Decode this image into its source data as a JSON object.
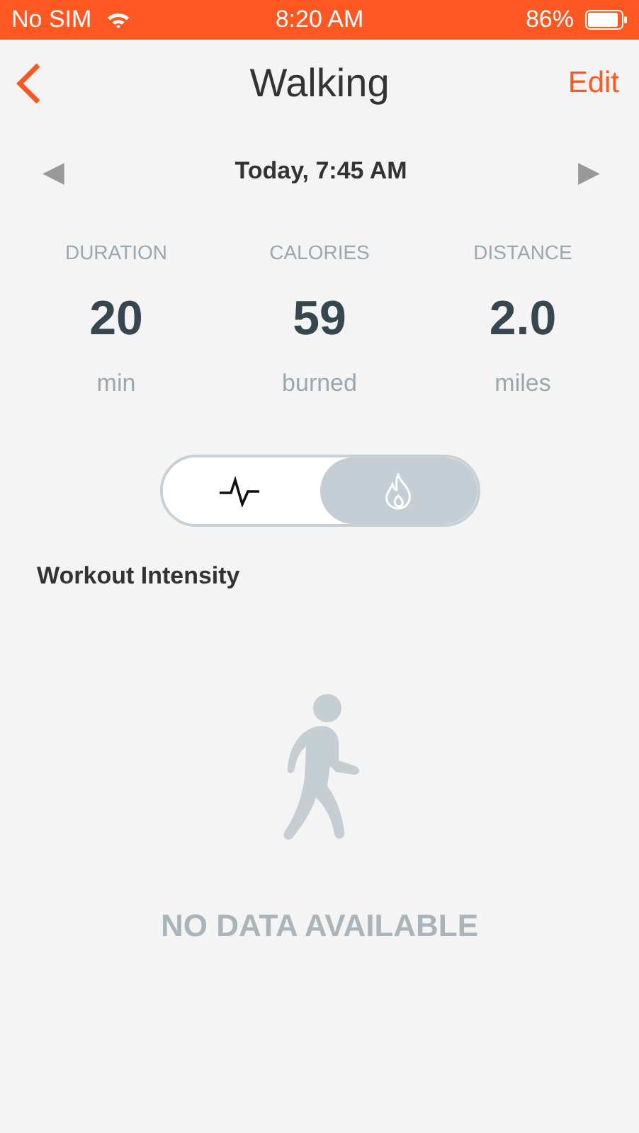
{
  "status_bar": {
    "carrier": "No SIM",
    "time": "8:20 AM",
    "battery": "86%"
  },
  "nav": {
    "title": "Walking",
    "action": "Edit"
  },
  "date_nav": {
    "prev": "◀",
    "label": "Today, 7:45 AM",
    "next": "▶"
  },
  "stats": [
    {
      "label": "DURATION",
      "value": "20",
      "unit": "min"
    },
    {
      "label": "CALORIES",
      "value": "59",
      "unit": "burned"
    },
    {
      "label": "DISTANCE",
      "value": "2.0",
      "unit": "miles"
    }
  ],
  "toggle": [
    {
      "kind": "pulse",
      "selected": false
    },
    {
      "kind": "flame",
      "selected": true
    }
  ],
  "section_title": "Workout Intensity",
  "empty_state": {
    "message": "NO DATA AVAILABLE"
  }
}
